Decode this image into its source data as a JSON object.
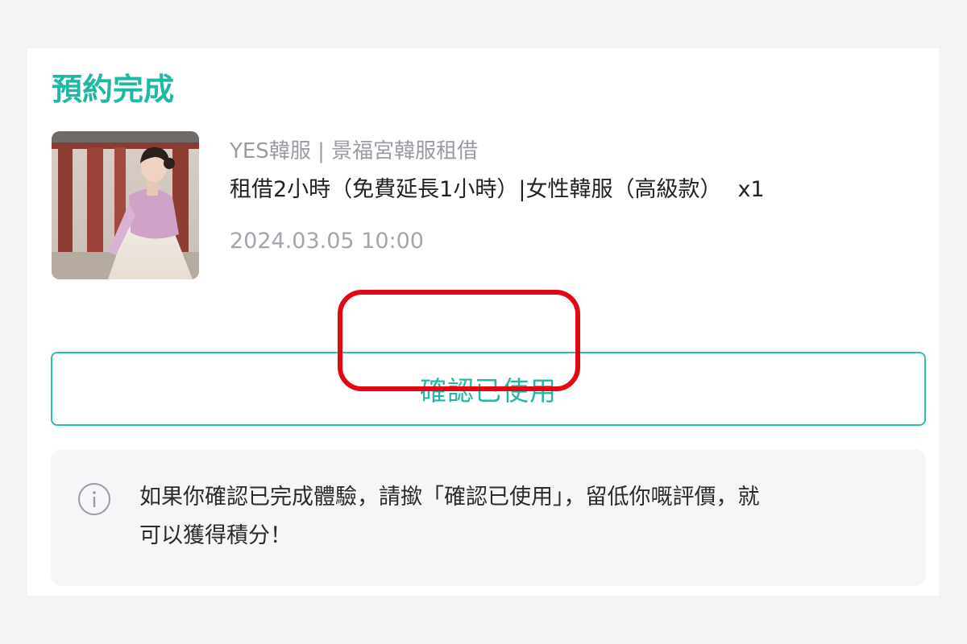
{
  "card": {
    "title": "預約完成",
    "merchant": "YES韓服 | 景福宮韓服租借",
    "product_name": "租借2小時（免費延長1小時）|女性韓服（高級款）",
    "quantity": "x1",
    "datetime": "2024.03.05 10:00",
    "thumbnail_icon": "hanbok-photo"
  },
  "confirm_button": {
    "label": "確認已使用"
  },
  "notice": {
    "icon": "info-icon",
    "line1": "如果你確認已完成體驗，請撳「確認已使用」，留低你嘅評價，就",
    "line2": "可以獲得積分！"
  },
  "colors": {
    "accent": "#1fb8a4",
    "highlight": "#e40613",
    "page_background": "#f4f4f5",
    "notice_background": "#f5f6f8"
  }
}
